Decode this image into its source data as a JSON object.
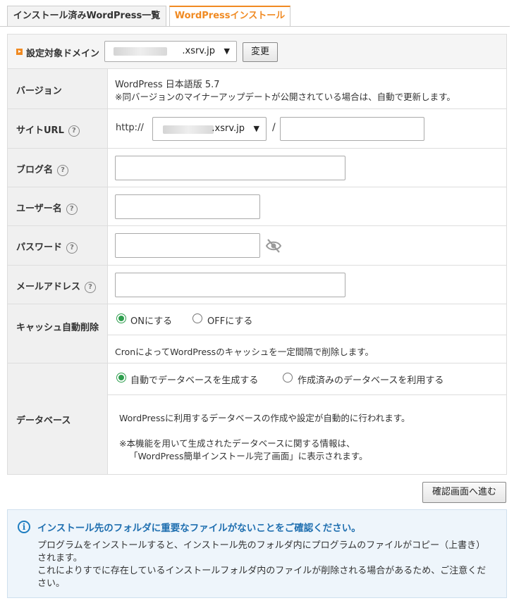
{
  "tabs": [
    {
      "label": "インストール済みWordPress一覧",
      "active": false
    },
    {
      "label": "WordPressインストール",
      "active": true
    }
  ],
  "domain_bar": {
    "label": "設定対象ドメイン",
    "selected_domain": ".xsrv.jp",
    "change_button": "変更"
  },
  "form": {
    "version": {
      "label": "バージョン",
      "value": "WordPress 日本語版 5.7",
      "note": "※同バージョンのマイナーアップデートが公開されている場合は、自動で更新します。"
    },
    "site_url": {
      "label": "サイトURL",
      "prefix": "http://",
      "domain": ".xsrv.jp",
      "separator": "/",
      "path_value": ""
    },
    "blog_name": {
      "label": "ブログ名",
      "value": ""
    },
    "username": {
      "label": "ユーザー名",
      "value": ""
    },
    "password": {
      "label": "パスワード",
      "value": "",
      "toggle_icon": "eye-slash-icon"
    },
    "email": {
      "label": "メールアドレス",
      "value": ""
    },
    "cache": {
      "label": "キャッシュ自動削除",
      "options": [
        {
          "label": "ONにする",
          "selected": true
        },
        {
          "label": "OFFにする",
          "selected": false
        }
      ],
      "description": "CronによってWordPressのキャッシュを一定間隔で削除します。"
    },
    "database": {
      "label": "データベース",
      "options": [
        {
          "label": "自動でデータベースを生成する",
          "selected": true
        },
        {
          "label": "作成済みのデータベースを利用する",
          "selected": false
        }
      ],
      "description": "WordPressに利用するデータベースの作成や設定が自動的に行われます。",
      "note_line1": "※本機能を用いて生成されたデータベースに関する情報は、",
      "note_line2": "「WordPress簡単インストール完了画面」に表示されます。"
    },
    "help_mark": "?"
  },
  "confirm_button": "確認画面へ進む",
  "notice": {
    "icon_letter": "i",
    "title": "インストール先のフォルダに重要なファイルがないことをご確認ください。",
    "body_line1": "プログラムをインストールすると、インストール先のフォルダ内にプログラムのファイルがコピー（上書き）されます。",
    "body_line2": "これによりすでに存在しているインストールフォルダ内のファイルが削除される場合があるため、ご注意ください。"
  },
  "colors": {
    "accent": "#f08a22",
    "radio_selected": "#2e9e4e",
    "notice_title": "#1f6fb0",
    "notice_bg": "#eef5fb"
  }
}
